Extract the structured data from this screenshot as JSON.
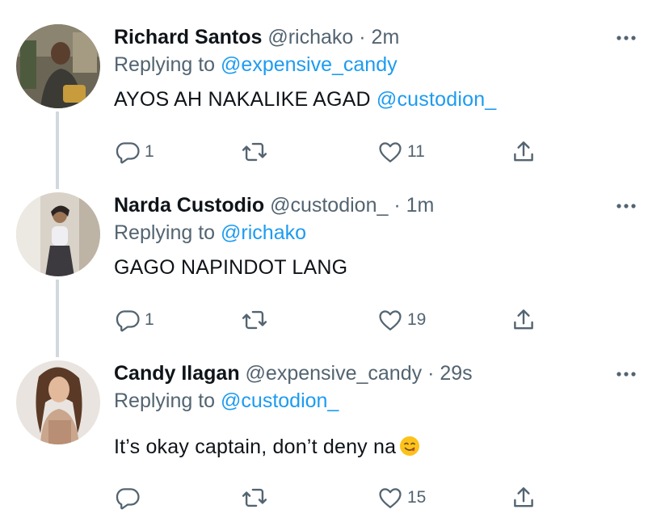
{
  "tweets": [
    {
      "name": "Richard Santos",
      "handle": "@richako",
      "separator": "·",
      "time": "2m",
      "replying_prefix": "Replying to",
      "replying_to": "@expensive_candy",
      "text": "AYOS AH NAKALIKE AGAD",
      "text_mention": "@custodion_",
      "replies": "1",
      "retweets": "",
      "likes": "11"
    },
    {
      "name": "Narda Custodio",
      "handle": "@custodion_",
      "separator": "·",
      "time": "1m",
      "replying_prefix": "Replying to",
      "replying_to": "@richako",
      "text": "GAGO NAPINDOT LANG",
      "text_mention": "",
      "replies": "1",
      "retweets": "",
      "likes": "19"
    },
    {
      "name": "Candy Ilagan",
      "handle": "@expensive_candy",
      "separator": "·",
      "time": "29s",
      "replying_prefix": "Replying to",
      "replying_to": "@custodion_",
      "text": "It’s okay captain, don’t deny na",
      "text_mention": "",
      "emoji": "smiling-face-savoring-food",
      "replies": "",
      "retweets": "",
      "likes": "15"
    }
  ],
  "icons": {
    "reply": "reply-icon",
    "retweet": "retweet-icon",
    "like": "like-icon",
    "share": "share-icon",
    "more": "more-icon"
  },
  "colors": {
    "link": "#1d9bf0",
    "secondary_text": "#536471",
    "thread_line": "#cfd9de"
  }
}
